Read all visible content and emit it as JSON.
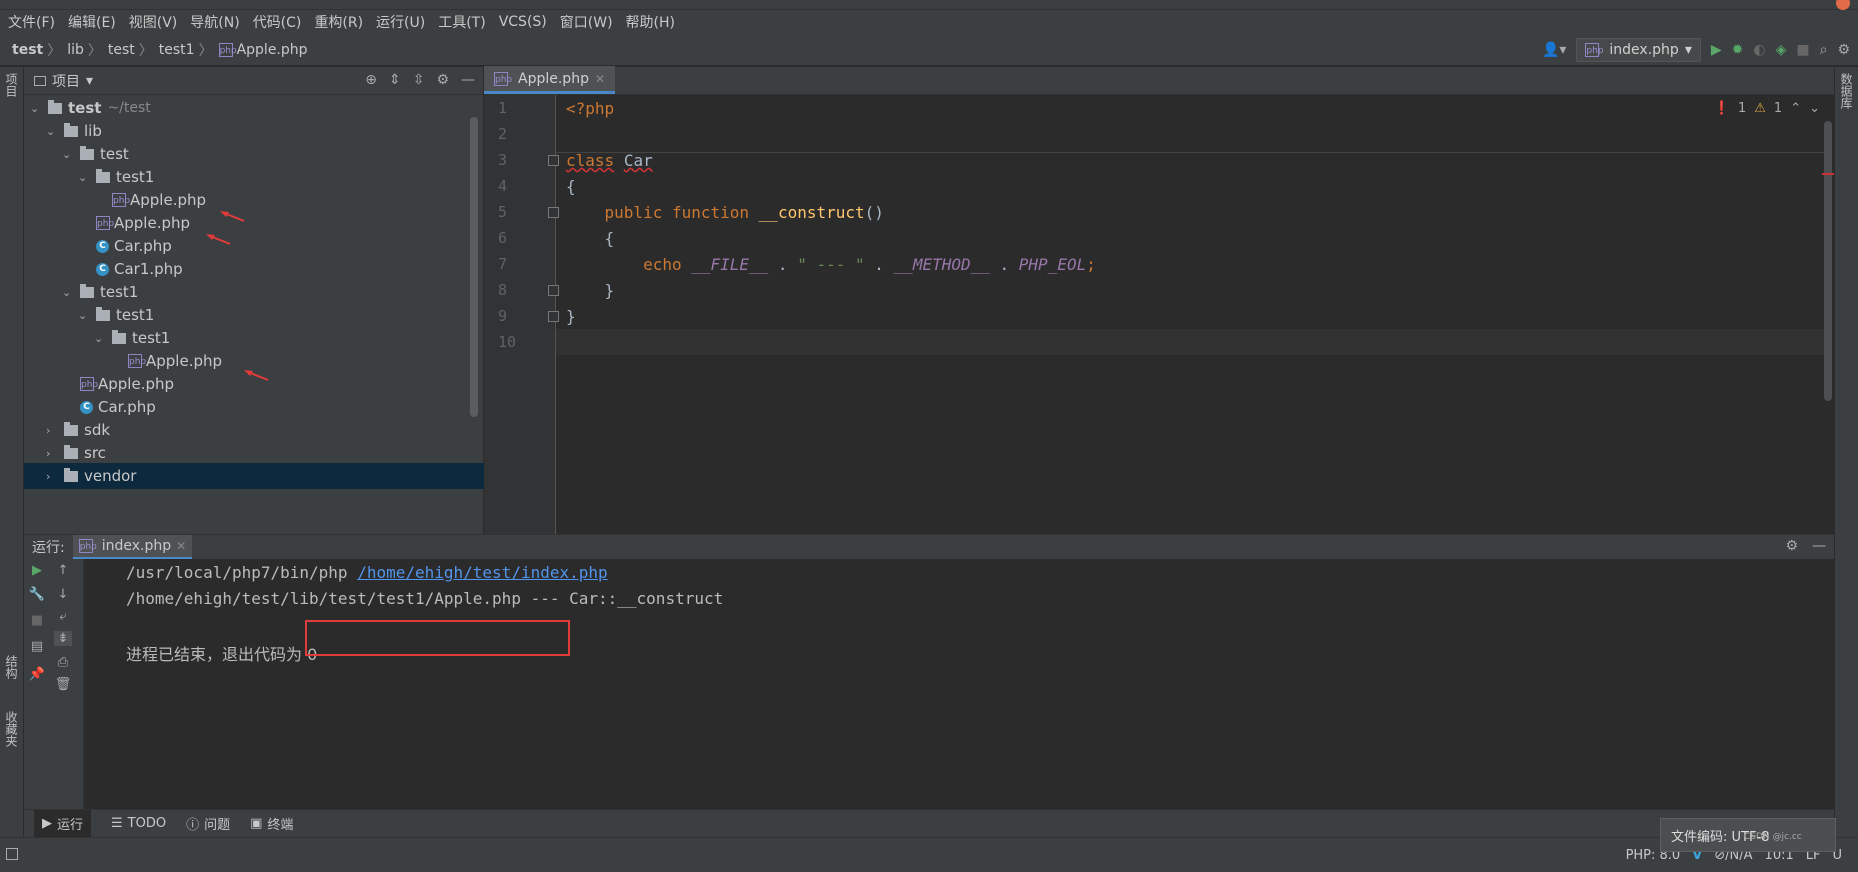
{
  "menubar": [
    "文件(F)",
    "编辑(E)",
    "视图(V)",
    "导航(N)",
    "代码(C)",
    "重构(R)",
    "运行(U)",
    "工具(T)",
    "VCS(S)",
    "窗口(W)",
    "帮助(H)"
  ],
  "breadcrumb": [
    "test",
    "lib",
    "test",
    "test1",
    "Apple.php"
  ],
  "toolbar": {
    "run_config": "index.php"
  },
  "left_strip": {
    "project": "项目",
    "structure": "结构",
    "favorites": "收藏夹"
  },
  "right_strip": {
    "database": "数据库"
  },
  "project_panel": {
    "title": "项目"
  },
  "tree": [
    {
      "label": "test",
      "muted": "~/test",
      "type": "folder"
    },
    {
      "label": "lib",
      "type": "folder"
    },
    {
      "label": "test",
      "type": "folder"
    },
    {
      "label": "test1",
      "type": "folder"
    },
    {
      "label": "Apple.php",
      "type": "php"
    },
    {
      "label": "Apple.php",
      "type": "php"
    },
    {
      "label": "Car.php",
      "type": "class"
    },
    {
      "label": "Car1.php",
      "type": "class"
    },
    {
      "label": "test1",
      "type": "folder"
    },
    {
      "label": "test1",
      "type": "folder"
    },
    {
      "label": "test1",
      "type": "folder"
    },
    {
      "label": "Apple.php",
      "type": "php"
    },
    {
      "label": "Apple.php",
      "type": "php"
    },
    {
      "label": "Car.php",
      "type": "class"
    },
    {
      "label": "sdk",
      "type": "folder"
    },
    {
      "label": "src",
      "type": "folder"
    },
    {
      "label": "vendor",
      "type": "folder"
    }
  ],
  "editor": {
    "tab": "Apple.php",
    "line_numbers": [
      "1",
      "2",
      "3",
      "4",
      "5",
      "6",
      "7",
      "8",
      "9",
      "10"
    ],
    "inspections": {
      "errors": "1",
      "warnings": "1"
    },
    "code": {
      "l1": "<?php",
      "l3_kw": "class",
      "l3_name": "Car",
      "l4": "{",
      "l5_kw": "public function",
      "l5_fn": "__construct",
      "l5_paren": "()",
      "l6": "{",
      "l7_kw": "echo",
      "l7_c1": "__FILE__",
      "l7_dot1": " . ",
      "l7_str": "\" --- \"",
      "l7_dot2": " . ",
      "l7_c2": "__METHOD__",
      "l7_dot3": " . ",
      "l7_c3": "PHP_EOL",
      "l7_semi": ";",
      "l8": "}",
      "l9": "}"
    }
  },
  "run_panel": {
    "label": "运行:",
    "tab": "index.php",
    "console": {
      "line1_cmd": "/usr/local/php7/bin/php ",
      "line1_link": "/home/ehigh/test/index.php",
      "line2": "/home/ehigh/test/lib/test/test1/Apple.php --- Car::__construct",
      "line3": "进程已结束，退出代码为 0"
    }
  },
  "bottom_tabs": {
    "run": "运行",
    "todo": "TODO",
    "problems": "问题",
    "terminal": "终端"
  },
  "statusbar": {
    "php": "PHP: 8.0",
    "vcs": "⊘/N/A",
    "position": "10:1",
    "lf": "LF",
    "encoding_short": "U"
  },
  "tooltip": "文件编码: UTF-8",
  "watermark": "CSDN @jc.cc"
}
